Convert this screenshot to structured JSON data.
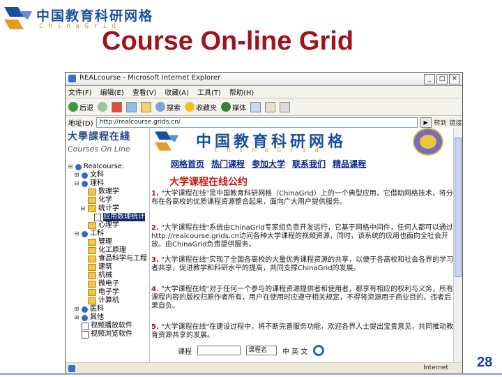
{
  "slide": {
    "logo_cn": "中国教育科研网格",
    "logo_en": "ChinaGrid",
    "title": "Course On-line Grid",
    "page_number": "28"
  },
  "browser": {
    "window_title": "REALcourse - Microsoft Internet Explorer",
    "menu": [
      "文件(F)",
      "编辑(E)",
      "查看(V)",
      "收藏(A)",
      "工具(T)",
      "帮助(H)"
    ],
    "toolbar": {
      "back": "后退",
      "search": "搜索",
      "favorites": "收藏夹",
      "media": "媒体"
    },
    "address_label": "地址(D)",
    "address_value": "http://realcourse.grids.cn/",
    "go_label": "转到",
    "links_label": "链接",
    "status_zone": "Internet"
  },
  "left_frame": {
    "logo_cn": "大學課程在綫",
    "logo_en": "Courses On Line",
    "tree": [
      {
        "label": "Realcourse:",
        "icon": "globe",
        "level": 0,
        "expand": "-"
      },
      {
        "label": "文科",
        "icon": "globe",
        "level": 1,
        "expand": "+"
      },
      {
        "label": "理科",
        "icon": "globe",
        "level": 1,
        "expand": "-"
      },
      {
        "label": "数理学",
        "icon": "folder",
        "level": 2,
        "expand": ""
      },
      {
        "label": "化学",
        "icon": "folder",
        "level": 2,
        "expand": ""
      },
      {
        "label": "统计学",
        "icon": "folder",
        "level": 2,
        "expand": "-"
      },
      {
        "label": "应用数理统计",
        "icon": "doc",
        "level": 3,
        "expand": "",
        "selected": true
      },
      {
        "label": "心理学",
        "icon": "folder",
        "level": 2,
        "expand": ""
      },
      {
        "label": "工科",
        "icon": "globe",
        "level": 1,
        "expand": "-"
      },
      {
        "label": "管理",
        "icon": "folder",
        "level": 2,
        "expand": ""
      },
      {
        "label": "化工原理",
        "icon": "folder",
        "level": 2,
        "expand": ""
      },
      {
        "label": "食品科学与工程",
        "icon": "folder",
        "level": 2,
        "expand": ""
      },
      {
        "label": "建筑",
        "icon": "folder",
        "level": 2,
        "expand": ""
      },
      {
        "label": "机械",
        "icon": "folder",
        "level": 2,
        "expand": ""
      },
      {
        "label": "微电子",
        "icon": "folder",
        "level": 2,
        "expand": ""
      },
      {
        "label": "电子学",
        "icon": "folder",
        "level": 2,
        "expand": ""
      },
      {
        "label": "计算机",
        "icon": "folder",
        "level": 2,
        "expand": ""
      },
      {
        "label": "医科",
        "icon": "globe",
        "level": 1,
        "expand": "+"
      },
      {
        "label": "其他",
        "icon": "globe",
        "level": 1,
        "expand": "+"
      },
      {
        "label": "视频播放软件",
        "icon": "doc",
        "level": 1,
        "expand": ""
      },
      {
        "label": "视频浏览软件",
        "icon": "doc",
        "level": 1,
        "expand": ""
      }
    ]
  },
  "right_frame": {
    "banner_cn": "中国教育科研网格",
    "banner_en": "ChinaGrid",
    "nav": [
      "网格首页",
      "热门课程",
      "参加大学",
      "联系我们",
      "精品课程"
    ],
    "heading": "大学课程在线公约",
    "paragraphs": [
      {
        "lead": "1.",
        "text": "\"大学课程在线\"是中国教育科研网格（ChinaGrid）上的一个典型应用，它借助网格技术，将分布在各高校的优质课程资源整合起来，面向广大用户提供服务。"
      },
      {
        "lead": "2.",
        "text": "\"大学课程在线\"系统由ChinaGrid专家组负责开发运行，它基于网格中间件，任何人都可以通过http://realcourse.grids.cn访问各种大学课程的视频资源，同时，该系统的应用也面向全社会开放。由ChinaGrid负责提供服务。"
      },
      {
        "lead": "3.",
        "text": "\"大学课程在线\"实现了全国各高校的大量优秀课程资源的共享，以便于各高校和社会各界的学习者共享，促进教学和科研水平的提高，共同支撑ChinaGrid的发展。"
      },
      {
        "lead": "4.",
        "text": "\"大学课程在线\"对于任何一个参与的课程资源提供者和使用者，都享有相应的权利与义务，所有课程内容的版权归原作者所有，用户在使用时应遵守相关规定，不得将资源用于商业目的，违者后果自负。"
      },
      {
        "lead": "5.",
        "text": "\"大学课程在线\"在建设过程中，将不断完善服务功能，欢迎各界人士提出宝贵意见，共同推动教育资源共享的发展。"
      }
    ],
    "bottom": {
      "search_field_label": "课程",
      "select_value": "课程名",
      "extra_label": "中 英 文"
    }
  }
}
